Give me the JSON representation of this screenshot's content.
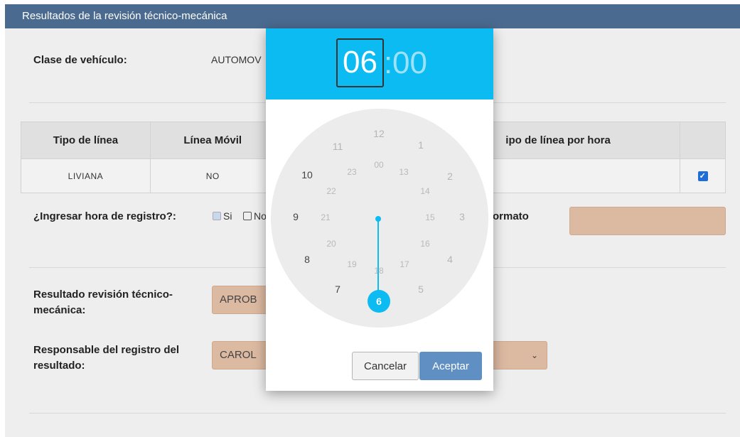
{
  "header": {
    "title": "Resultados de la revisión técnico-mecánica"
  },
  "vehicle": {
    "label": "Clase de vehículo:",
    "value": "AUTOMOV"
  },
  "lines_table": {
    "headers": [
      "Tipo de línea",
      "Línea Móvil",
      "",
      "ipo de línea por hora",
      ""
    ],
    "row": {
      "tipo": "LIVIANA",
      "movil": "NO"
    }
  },
  "registro": {
    "label": "¿Ingresar hora de registro?:",
    "si": "Si",
    "no": "No",
    "formato_label": "ormato"
  },
  "resultado": {
    "label": "Resultado revisión técnico-mecánica:",
    "value": "APROB"
  },
  "responsable": {
    "label": "Responsable del registro del resultado:",
    "value": "CAROL"
  },
  "picker": {
    "hours": "06",
    "separator": ":",
    "minutes": "00",
    "selected": "6",
    "outer": [
      "12",
      "1",
      "2",
      "3",
      "4",
      "5",
      "7",
      "8",
      "9",
      "10",
      "11"
    ],
    "inner": [
      "00",
      "13",
      "14",
      "15",
      "16",
      "17",
      "18",
      "19",
      "20",
      "21",
      "22",
      "23"
    ],
    "cancel": "Cancelar",
    "ok": "Aceptar"
  },
  "colors": {
    "header": "#4a6a8f",
    "accent": "#0bbbf2",
    "ok": "#5f8fc3",
    "field": "#dcb9a1"
  }
}
